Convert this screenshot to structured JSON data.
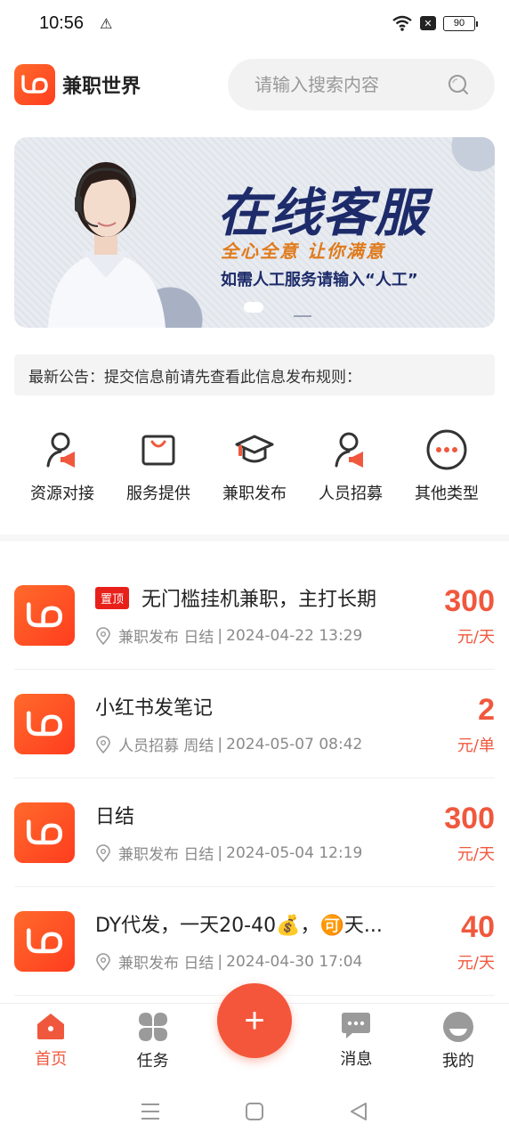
{
  "status_bar": {
    "time": "10:56",
    "battery": "90"
  },
  "header": {
    "app_name": "兼职世界",
    "search_placeholder": "请输入搜索内容"
  },
  "banner": {
    "title": "在线客服",
    "slogan": "全心全意  让你满意",
    "hint": "如需人工服务请输入“人工”"
  },
  "notice": {
    "text": "最新公告：提交信息前请先查看此信息发布规则："
  },
  "categories": [
    {
      "label": "资源对接",
      "icon": "person-megaphone-icon"
    },
    {
      "label": "服务提供",
      "icon": "shopping-bag-icon"
    },
    {
      "label": "兼职发布",
      "icon": "graduation-cap-icon"
    },
    {
      "label": "人员招募",
      "icon": "person-megaphone-icon"
    },
    {
      "label": "其他类型",
      "icon": "more-icon"
    }
  ],
  "jobs": [
    {
      "badge": "置顶",
      "title": "无门槛挂机兼职，主打长期",
      "category": "兼职发布",
      "settle": "日结",
      "time": "2024-04-22 13:29",
      "amount": "300",
      "unit": "元/天"
    },
    {
      "badge": "",
      "title": "小红书发笔记",
      "category": "人员招募",
      "settle": "周结",
      "time": "2024-05-07 08:42",
      "amount": "2",
      "unit": "元/单"
    },
    {
      "badge": "",
      "title": "日结",
      "category": "兼职发布",
      "settle": "日结",
      "time": "2024-05-04 12:19",
      "amount": "300",
      "unit": "元/天"
    },
    {
      "badge": "",
      "title": "DY代发，一天20-40💰，🉑天...",
      "category": "兼职发布",
      "settle": "日结",
      "time": "2024-04-30 17:04",
      "amount": "40",
      "unit": "元/天"
    }
  ],
  "tabbar": {
    "home": "首页",
    "tasks": "任务",
    "add": "+",
    "messages": "消息",
    "mine": "我的"
  },
  "colors": {
    "accent": "#f0583d",
    "brand": "#ff4d25",
    "notice_bg": "#f4f4f4"
  }
}
